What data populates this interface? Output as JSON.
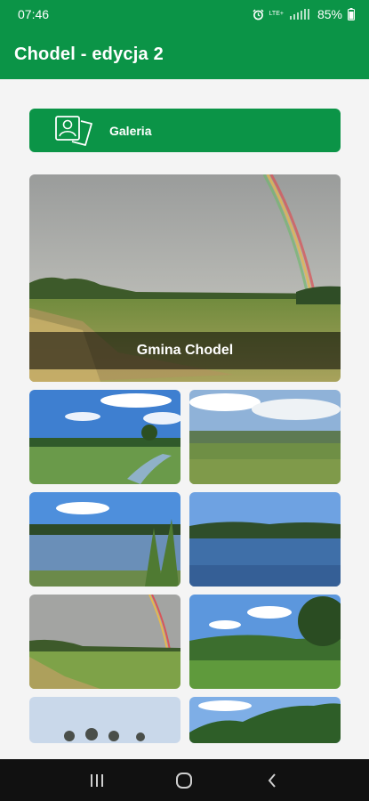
{
  "status": {
    "time": "07:46",
    "battery": "85%",
    "network": "LTE+"
  },
  "app": {
    "title": "Chodel - edycja 2"
  },
  "gallery_button": {
    "label": "Galeria",
    "icon": "gallery-portrait-icon"
  },
  "hero": {
    "caption": "Gmina Chodel",
    "scene": "rainbow-over-field"
  },
  "grid": [
    {
      "scene": "meadow-stream"
    },
    {
      "scene": "cloudy-landscape"
    },
    {
      "scene": "lake-reeds"
    },
    {
      "scene": "blue-lake"
    },
    {
      "scene": "rainbow-field"
    },
    {
      "scene": "green-hills"
    },
    {
      "scene": "trees-sky"
    },
    {
      "scene": "forest-edge"
    }
  ],
  "nav": {
    "recent": "recents-icon",
    "home": "home-icon",
    "back": "back-icon"
  },
  "colors": {
    "primary": "#0b9447",
    "nav_bar": "#111111",
    "background": "#f4f4f4"
  }
}
